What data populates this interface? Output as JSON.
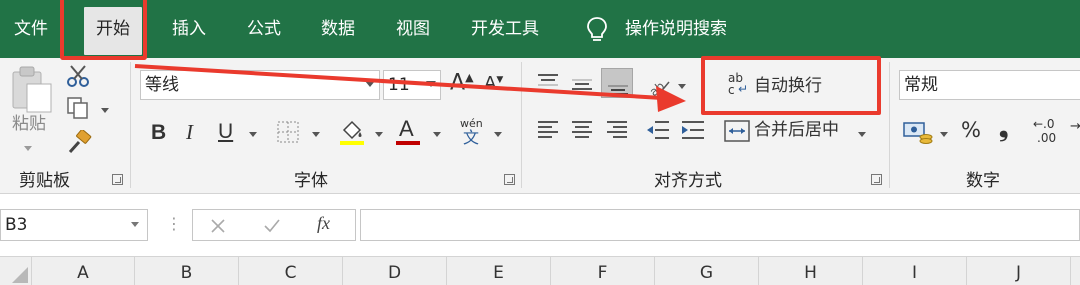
{
  "tabs": {
    "file": "文件",
    "home": "开始",
    "insert": "插入",
    "formulas": "公式",
    "data": "数据",
    "view": "视图",
    "developer": "开发工具",
    "tell_me": "操作说明搜索"
  },
  "clipboard": {
    "paste_label": "粘贴",
    "group_label": "剪贴板"
  },
  "font": {
    "font_name": "等线",
    "font_size": "11",
    "bold": "B",
    "italic": "I",
    "underline": "U",
    "font_color_glyph": "A",
    "grow_glyph": "A",
    "shrink_glyph": "A",
    "phonetic_top": "wén",
    "phonetic_bottom": "文",
    "group_label": "字体"
  },
  "alignment": {
    "wrap_text_icon_top": "ab",
    "wrap_text_icon_bottom": "c",
    "wrap_text": "自动换行",
    "merge_center": "合并后居中",
    "group_label": "对齐方式"
  },
  "number": {
    "format": "常规",
    "percent": "%",
    "comma": "❟",
    "increase_decimal_top": "←.0",
    "increase_decimal_bottom": ".00",
    "group_label": "数字"
  },
  "formula_bar": {
    "name_box": "B3",
    "fx": "fx",
    "value": ""
  },
  "columns": [
    "A",
    "B",
    "C",
    "D",
    "E",
    "F",
    "G",
    "H",
    "I",
    "J"
  ],
  "colors": {
    "tab_bar": "#217346",
    "annotation_red": "#ea3a2d",
    "font_color_bar": "#c00000",
    "fill_color_bar": "#ffff00"
  }
}
